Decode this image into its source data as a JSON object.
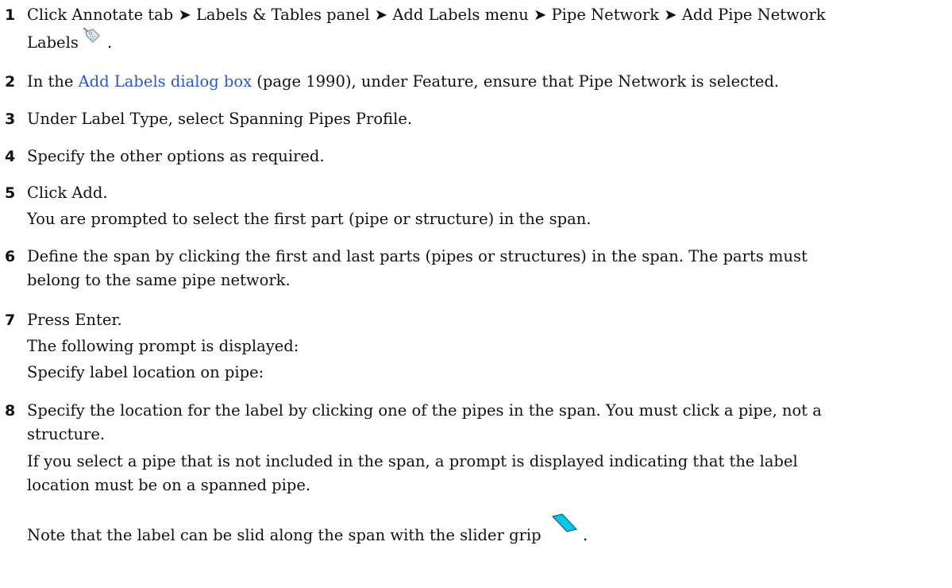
{
  "steps": [
    {
      "num": "1",
      "text_a": "Click Annotate tab ➤ Labels & Tables panel ➤ Add Labels menu ➤ Pipe Network ➤ Add Pipe Network",
      "text_b": "Labels",
      "text_b_end": " ."
    },
    {
      "num": "2",
      "pre": "In the ",
      "link": "Add Labels dialog box",
      "post": " (page 1990), under Feature, ensure that Pipe Network is selected."
    },
    {
      "num": "3",
      "text": "Under Label Type, select Spanning Pipes Profile."
    },
    {
      "num": "4",
      "text": "Specify the other options as required."
    },
    {
      "num": "5",
      "text": "Click Add.",
      "note": "You are prompted to select the first part (pipe or structure) in the span."
    },
    {
      "num": "6",
      "text_a": "Define the span by clicking the first and last parts (pipes or structures) in the span. The parts must",
      "text_b": "belong to the same pipe network."
    },
    {
      "num": "7",
      "text": "Press Enter.",
      "note1": "The following prompt is displayed:",
      "note2": "Specify label location on pipe:"
    },
    {
      "num": "8",
      "text_a": "Specify the location for the label by clicking one of the pipes in the span. You must click a pipe, not a",
      "text_b": "structure.",
      "note_a": "If you select a pipe that is not included in the span, a prompt is displayed indicating that the label",
      "note_b": "location must be on a spanned pipe.",
      "final": "Note that the label can be slid along the span with the slider grip",
      "final_end": " ."
    }
  ],
  "icons": {
    "label_tag": "add-pipe-network-labels-icon",
    "slider_grip": "slider-grip-icon",
    "grip_color": "#00c8e6",
    "link_color": "#2a58c6"
  }
}
